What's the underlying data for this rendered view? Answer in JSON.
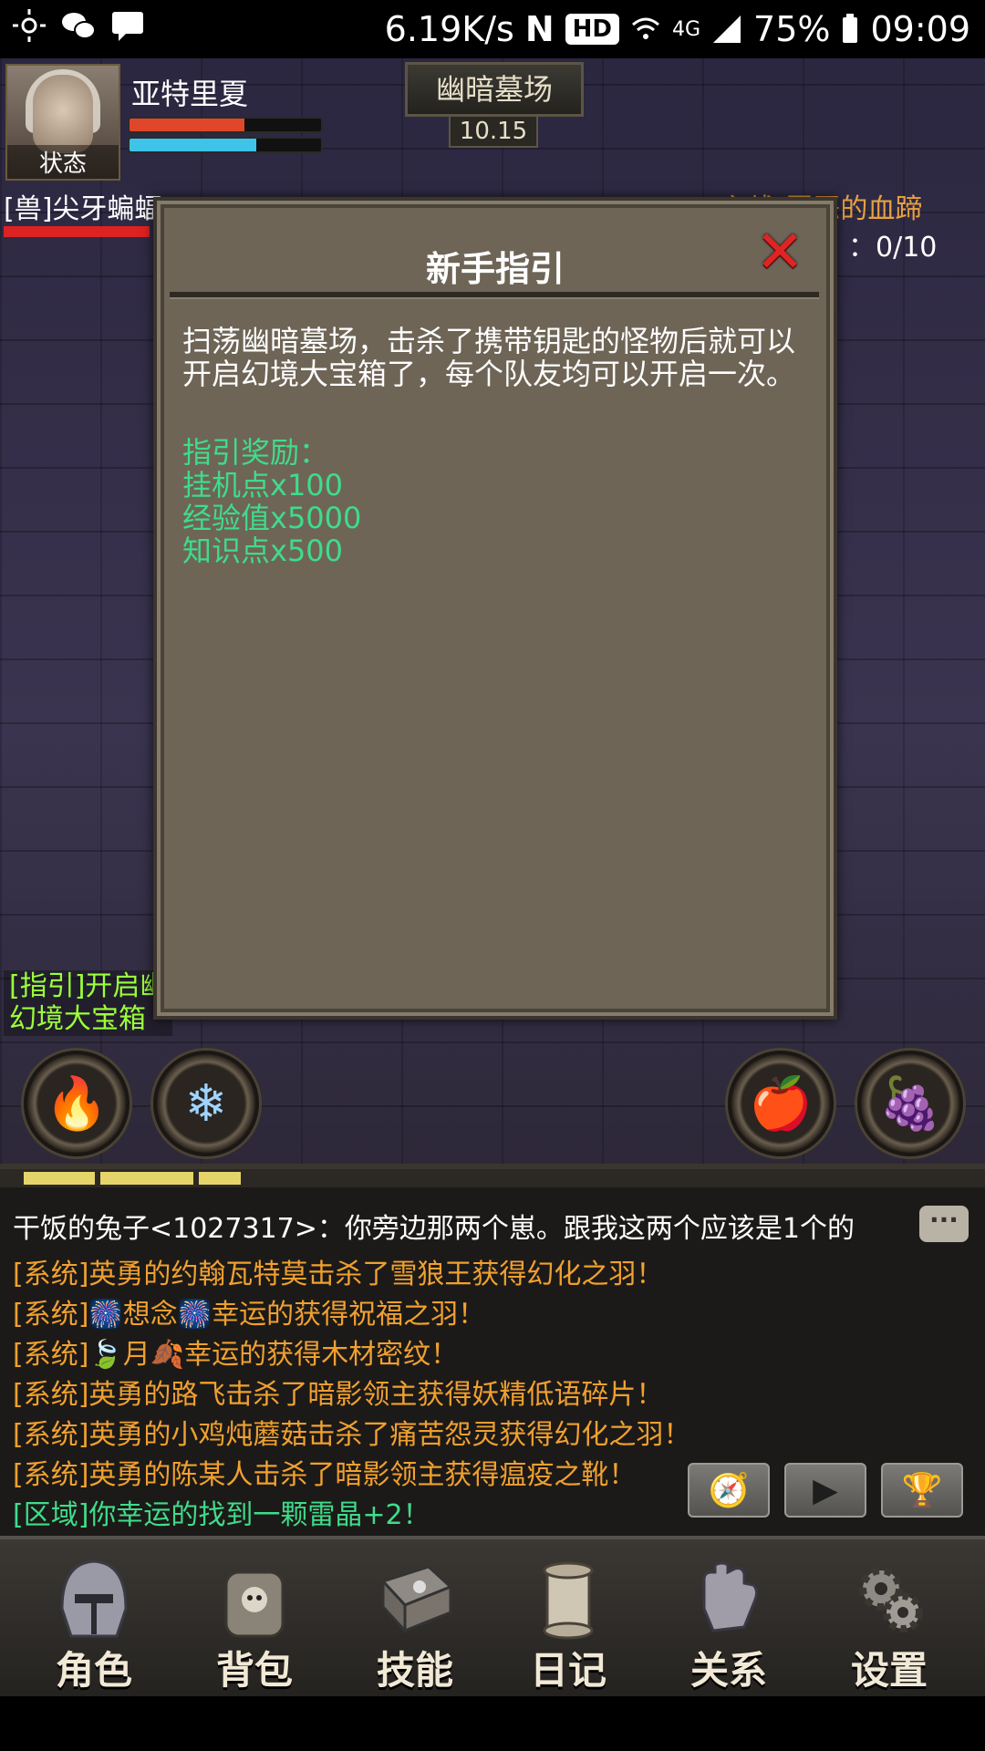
{
  "status_bar": {
    "network_speed": "6.19K/s",
    "nfc": "N",
    "hd": "HD",
    "signal": "4G",
    "battery": "75%",
    "time": "09:09",
    "left_icons": [
      "sun-icon",
      "wechat-icon",
      "message-icon"
    ]
  },
  "hud": {
    "player_name": "亚特里夏",
    "portrait_label": "状态",
    "hp_fill": 0.6,
    "mp_fill": 0.66,
    "map_name": "幽暗墓场",
    "map_coord": "10.15",
    "target_name": "[兽]尖牙蝙蝠",
    "quest_title": "[主线]罪恶的血蹄",
    "quest_progress": "：0/10",
    "guide_tip_line1": "[指引]开启幽",
    "guide_tip_line2": "幻境大宝箱"
  },
  "dialog": {
    "title": "新手指引",
    "body": "扫荡幽暗墓场，击杀了携带钥匙的怪物后就可以开启幻境大宝箱了，每个队友均可以开启一次。",
    "reward_heading": "指引奖励：",
    "rewards": [
      "挂机点x100",
      "经验值x5000",
      "知识点x500"
    ]
  },
  "chat": {
    "lines": [
      {
        "text": "干饭的兔子<1027317>：你旁边那两个崽。跟我这两个应该是1个的",
        "color": "#ffffff"
      },
      {
        "text": "[系统]英勇的约翰瓦特莫击杀了雪狼王获得幻化之羽！",
        "color": "#f0a030"
      },
      {
        "text": "[系统]🎆想念🎆幸运的获得祝福之羽！",
        "color": "#f0a030"
      },
      {
        "text": "[系统]🍃月🍂幸运的获得木材密纹！",
        "color": "#f0a030"
      },
      {
        "text": "[系统]英勇的路飞击杀了暗影领主获得妖精低语碎片！",
        "color": "#f0a030"
      },
      {
        "text": "[系统]英勇的小鸡炖蘑菇击杀了痛苦怨灵获得幻化之羽！",
        "color": "#f0a030"
      },
      {
        "text": "[系统]英勇的陈某人击杀了暗影领主获得瘟疫之靴！",
        "color": "#f0a030"
      },
      {
        "text": "[区域]你幸运的找到一颗雷晶+2！",
        "color": "#3fdc8a"
      }
    ],
    "bubble": "···",
    "controls": [
      "compass-icon",
      "play-icon",
      "trophy-icon"
    ]
  },
  "nav": {
    "items": [
      {
        "label": "角色",
        "icon": "helmet-icon"
      },
      {
        "label": "背包",
        "icon": "backpack-icon"
      },
      {
        "label": "技能",
        "icon": "spellbook-icon"
      },
      {
        "label": "日记",
        "icon": "scroll-icon"
      },
      {
        "label": "关系",
        "icon": "gauntlet-icon"
      },
      {
        "label": "设置",
        "icon": "gear-icon"
      }
    ]
  },
  "skills": {
    "left": [
      "fire-skill-icon",
      "frost-shield-icon"
    ],
    "right": [
      "apple-icon",
      "grapes-icon"
    ]
  }
}
